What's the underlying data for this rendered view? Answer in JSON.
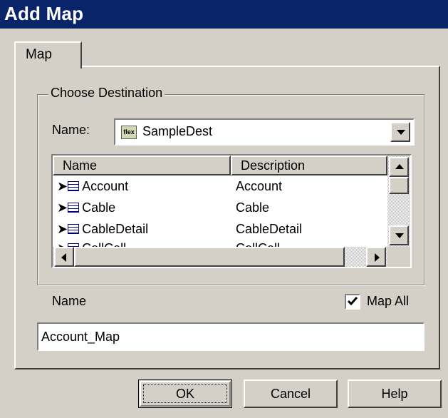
{
  "window": {
    "title": "Add Map"
  },
  "tabs": [
    {
      "label": "Map"
    }
  ],
  "group": {
    "label": "Choose Destination",
    "name_label": "Name:",
    "combo_value": "SampleDest",
    "combo_icon": "flex-file-icon"
  },
  "list": {
    "columns": [
      "Name",
      "Description"
    ],
    "rows": [
      {
        "name": "Account",
        "description": "Account"
      },
      {
        "name": "Cable",
        "description": "Cable"
      },
      {
        "name": "CableDetail",
        "description": "CableDetail"
      },
      {
        "name": "CellCell",
        "description": "CellCell"
      }
    ]
  },
  "map_name": {
    "label": "Name",
    "map_all_label": "Map All",
    "map_all_checked": true,
    "value": "Account_Map"
  },
  "buttons": {
    "ok": "OK",
    "cancel": "Cancel",
    "help": "Help"
  },
  "colors": {
    "titlebar": "#0a246a",
    "face": "#d4d0c8",
    "highlight_text": "#ffffff"
  }
}
